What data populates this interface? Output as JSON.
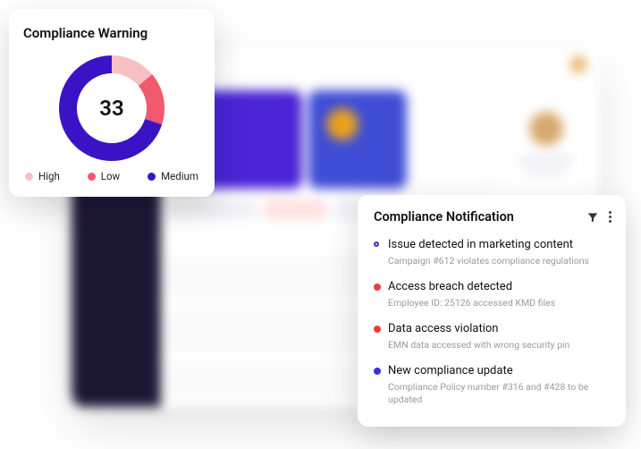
{
  "warning": {
    "title": "Compliance Warning",
    "value": "33",
    "legend": {
      "high": "High",
      "low": "Low",
      "medium": "Medium"
    }
  },
  "notifications": {
    "title": "Compliance Notification",
    "items": [
      {
        "title": "Issue detected in marketing content",
        "subtitle": "Campaign #612 violates compliance regulations",
        "bullet": "ring-blue"
      },
      {
        "title": "Access breach detected",
        "subtitle": "Employee ID: 25126 accessed KMD files",
        "bullet": "red"
      },
      {
        "title": "Data access violation",
        "subtitle": "EMN data accessed with wrong security pin",
        "bullet": "red"
      },
      {
        "title": "New compliance update",
        "subtitle": "Compliance Policy number\n#316 and #428 to be updated",
        "bullet": "blue"
      }
    ]
  },
  "chart_data": {
    "type": "pie",
    "title": "Compliance Warning",
    "total_label": "33",
    "series": [
      {
        "name": "High",
        "color": "#f7bfc3",
        "angle_deg": 50
      },
      {
        "name": "Low",
        "color": "#f05a6e",
        "angle_deg": 58
      },
      {
        "name": "Medium",
        "color": "#3a13c6",
        "angle_deg": 252
      }
    ]
  }
}
